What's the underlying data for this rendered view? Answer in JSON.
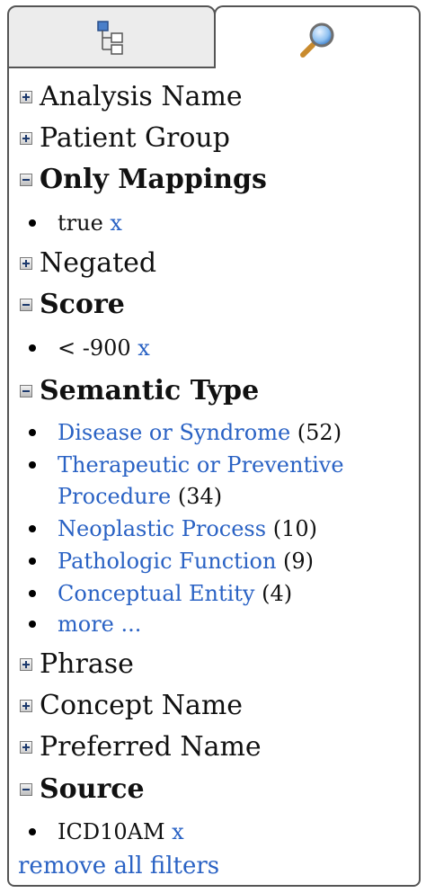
{
  "tabs": [
    {
      "name": "hierarchy",
      "icon": "hierarchy-tree-icon"
    },
    {
      "name": "search",
      "icon": "magnifier-icon",
      "active": true
    }
  ],
  "facets": {
    "analysis_name": {
      "label": "Analysis Name",
      "expanded": false
    },
    "patient_group": {
      "label": "Patient Group",
      "expanded": false
    },
    "only_mappings": {
      "label": "Only Mappings",
      "expanded": true,
      "selected": "true",
      "remove": "x"
    },
    "negated": {
      "label": "Negated",
      "expanded": false
    },
    "score": {
      "label": "Score",
      "expanded": true,
      "selected": "< -900",
      "remove": "x"
    },
    "semantic_type": {
      "label": "Semantic Type",
      "expanded": true,
      "items": [
        {
          "label": "Disease or Syndrome",
          "count": "(52)"
        },
        {
          "label_line1": "Therapeutic or Preventive",
          "label_line2": "Procedure",
          "count": "(34)"
        },
        {
          "label": "Neoplastic Process",
          "count": "(10)"
        },
        {
          "label": "Pathologic Function",
          "count": "(9)"
        },
        {
          "label": "Conceptual Entity",
          "count": "(4)"
        }
      ],
      "more": "more ..."
    },
    "phrase": {
      "label": "Phrase",
      "expanded": false
    },
    "concept_name": {
      "label": "Concept Name",
      "expanded": false
    },
    "preferred_name": {
      "label": "Preferred Name",
      "expanded": false
    },
    "source": {
      "label": "Source",
      "expanded": true,
      "selected": "ICD10AM",
      "remove": "x"
    }
  },
  "remove_all": "remove all filters",
  "colors": {
    "link": "#2a62c4",
    "border": "#555555",
    "inactive_tab": "#ececec"
  }
}
